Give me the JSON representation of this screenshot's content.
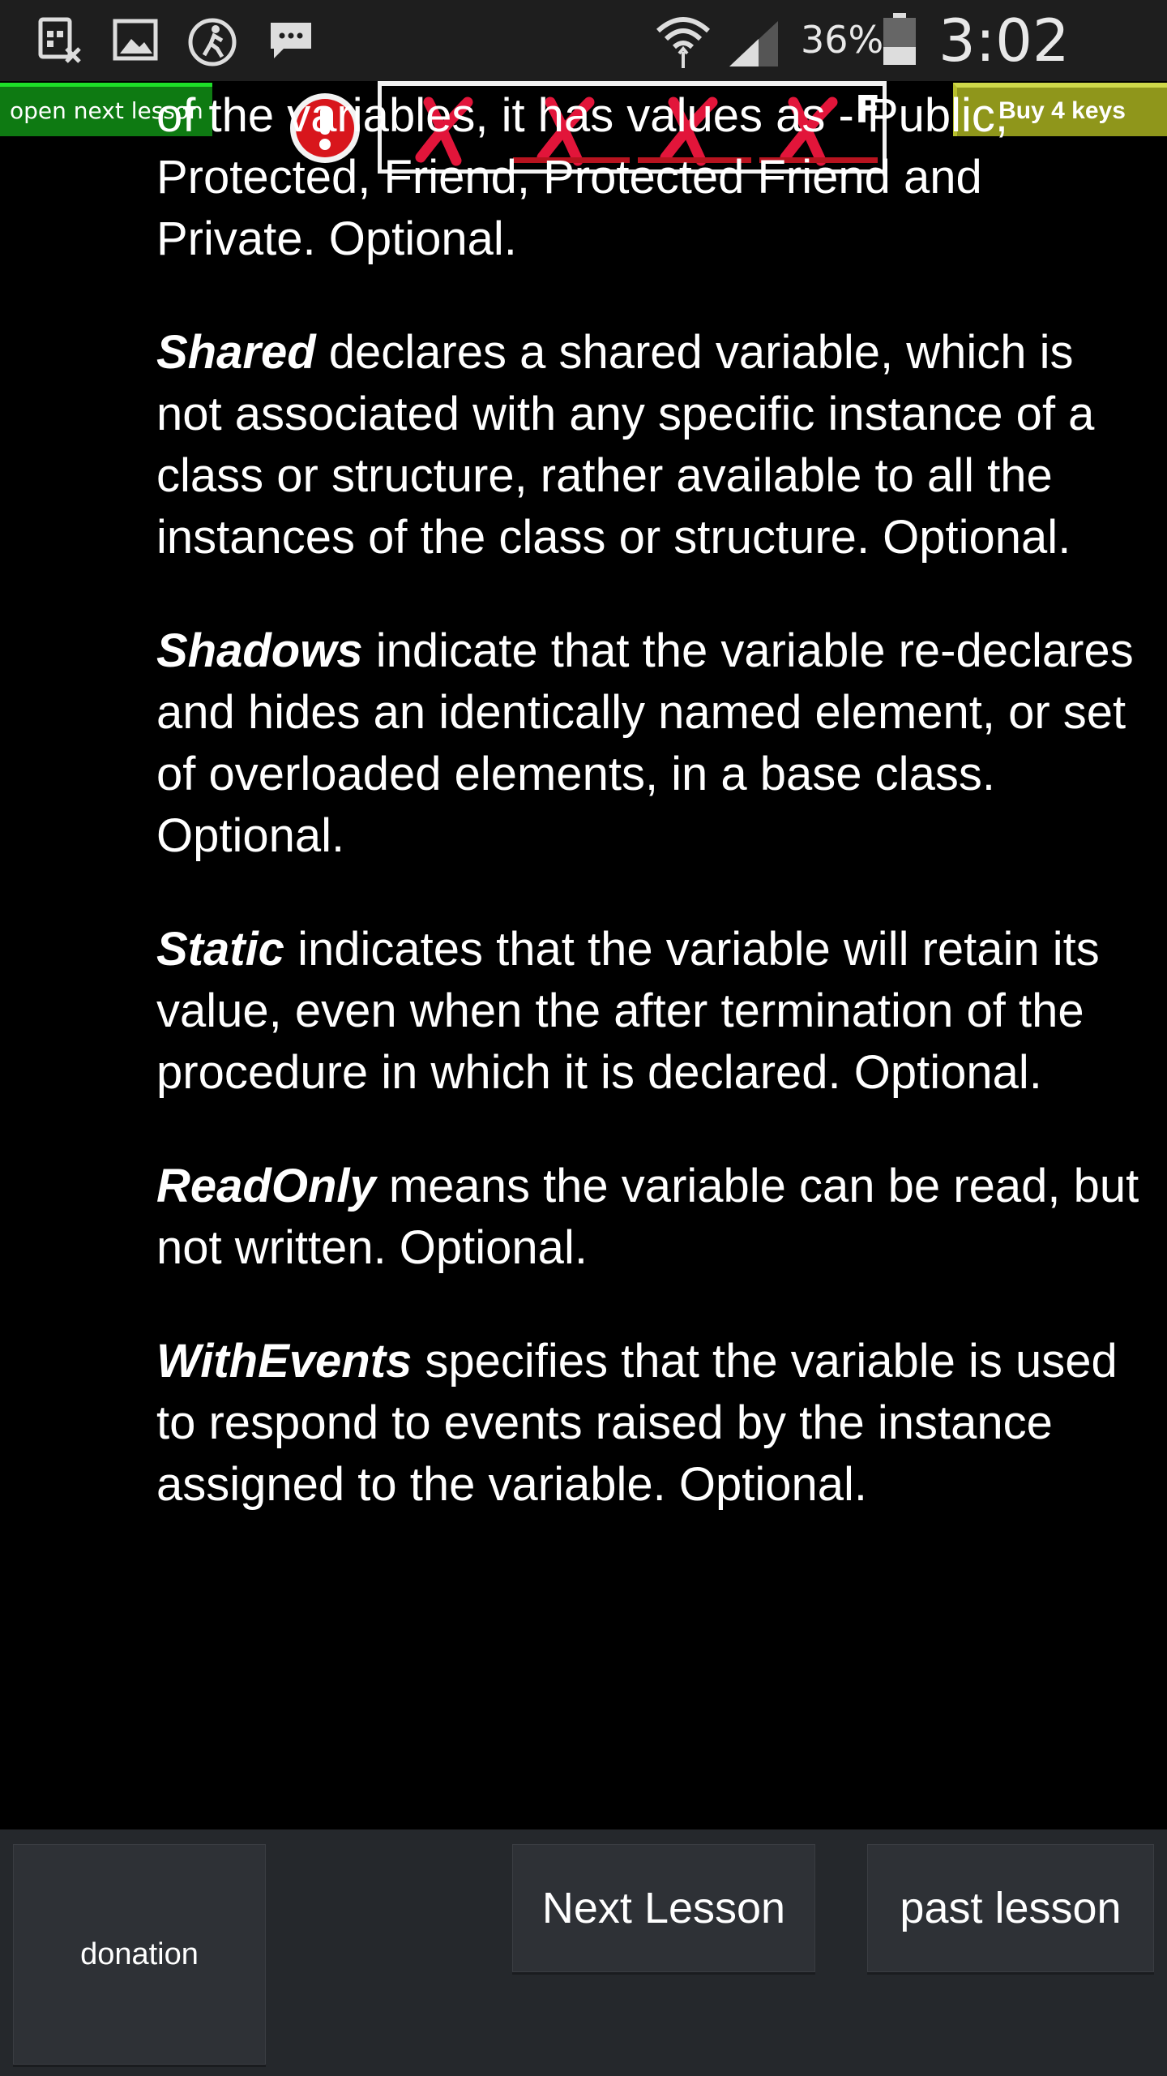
{
  "status_bar": {
    "icons": [
      "sim-card-icon",
      "gallery-icon",
      "running-icon",
      "messenger-icon",
      "wifi-icon",
      "signal-icon",
      "battery-icon"
    ],
    "battery_percent": "36%",
    "time": "3:02 PM"
  },
  "ad_strip": {
    "open_next_label": "open next lesson",
    "keys_letter": "F",
    "buy_keys_label": "Buy 4 keys",
    "colors": {
      "green": "#0e7a12",
      "key_red": "#e2153a",
      "olive": "#8f961b"
    }
  },
  "content": {
    "cut_paragraph": "of the variables, it has values as - Public, Protected, Friend, Protected Friend and Private. Optional.",
    "paragraphs": [
      {
        "term": "Shared",
        "text": " declares a shared variable, which is not associated with any specific instance of a class or structure, rather available to all the instances of the class or structure. Optional."
      },
      {
        "term": "Shadows",
        "text": " indicate that the variable re-declares and hides an identically named element, or set of overloaded elements, in a base class. Optional."
      },
      {
        "term": "Static",
        "text": " indicates that the variable will retain its value, even when the after termination of the procedure in which it is declared. Optional."
      },
      {
        "term": "ReadOnly",
        "text": " means the variable can be read, but not written. Optional."
      },
      {
        "term": "WithEvents",
        "text": " specifies that the variable is used to respond to events raised by the instance assigned to the variable. Optional."
      }
    ]
  },
  "bottom_bar": {
    "donation_label": "donation",
    "next_label": "Next Lesson",
    "past_label": "past lesson"
  }
}
